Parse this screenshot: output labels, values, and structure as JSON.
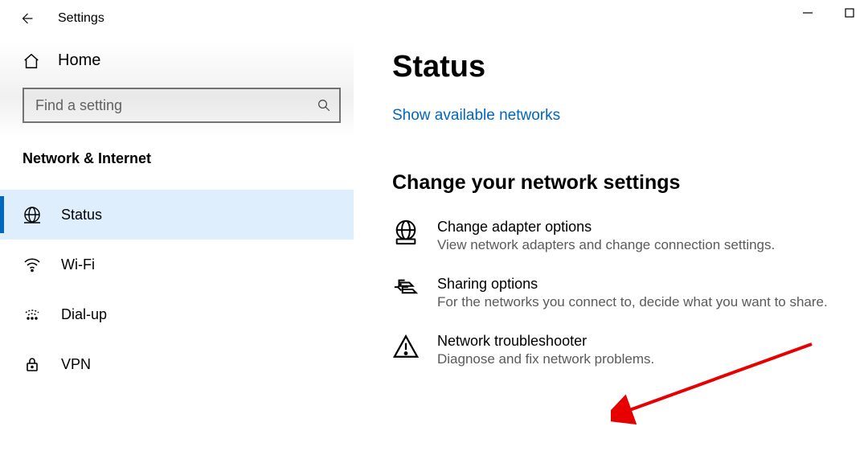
{
  "titlebar": {
    "app": "Settings"
  },
  "sidebar": {
    "home": "Home",
    "search_placeholder": "Find a setting",
    "category": "Network & Internet",
    "items": [
      {
        "label": "Status"
      },
      {
        "label": "Wi-Fi"
      },
      {
        "label": "Dial-up"
      },
      {
        "label": "VPN"
      }
    ]
  },
  "main": {
    "title": "Status",
    "link_show_networks": "Show available networks",
    "section_title": "Change your network settings",
    "options": [
      {
        "label": "Change adapter options",
        "desc": "View network adapters and change connection settings."
      },
      {
        "label": "Sharing options",
        "desc": "For the networks you connect to, decide what you want to share."
      },
      {
        "label": "Network troubleshooter",
        "desc": "Diagnose and fix network problems."
      }
    ]
  }
}
